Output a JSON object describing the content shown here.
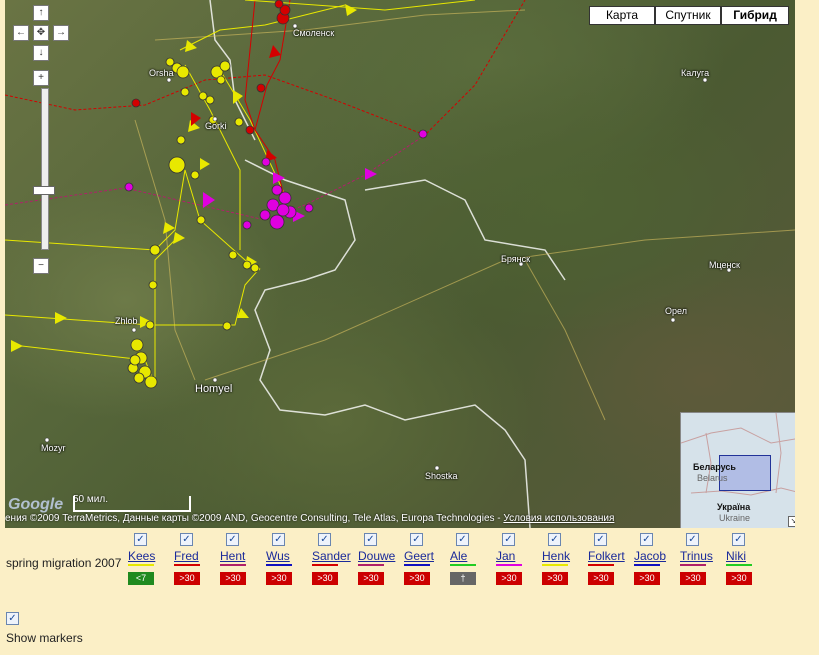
{
  "map_types": [
    "Карта",
    "Спутник",
    "Гибрид"
  ],
  "active_map_type": "Гибрид",
  "pan_arrows": {
    "up": "↑",
    "left": "←",
    "center": "✥",
    "right": "→",
    "down": "↓"
  },
  "zoom": {
    "in": "+",
    "out": "−"
  },
  "cities": [
    {
      "key": "smolensk",
      "label": "Смоленск"
    },
    {
      "key": "kaluga",
      "label": "Калуга"
    },
    {
      "key": "orsha",
      "label": "Orsha"
    },
    {
      "key": "gorki",
      "label": "Gorki"
    },
    {
      "key": "bryansk",
      "label": "Брянск"
    },
    {
      "key": "mtsensk",
      "label": "Мценск"
    },
    {
      "key": "orel",
      "label": "Орел"
    },
    {
      "key": "zhlobin",
      "label": "Zhlob"
    },
    {
      "key": "homyel",
      "label": "Homyel"
    },
    {
      "key": "mozyr",
      "label": "Mozyr"
    },
    {
      "key": "shostka",
      "label": "Shostka"
    }
  ],
  "scale_label": "50 мил.",
  "logo": "Google",
  "copyright": "ения ©2009 TerraMetrics, Данные карты ©2009 AND, Geocentre Consulting, Tele Atlas, Europa Technologies - ",
  "terms_link": "Условия использования",
  "minimap": {
    "label_belarus": "Беларусь",
    "label_belarus_en": "Belarus",
    "label_ukraine": "Україна",
    "label_ukraine_en": "Ukraine"
  },
  "legend": {
    "caption": "spring migration 2007",
    "checkbox_mark": "✓",
    "birds": [
      {
        "name": "Kees",
        "color": "#e8e800",
        "status": "<7",
        "status_color": "#1f8a1f"
      },
      {
        "name": "Fred",
        "color": "#d40000",
        "status": ">30",
        "status_color": "#cc0000"
      },
      {
        "name": "Hent",
        "color": "#b0206a",
        "status": ">30",
        "status_color": "#cc0000"
      },
      {
        "name": "Wus",
        "color": "#1010c0",
        "status": ">30",
        "status_color": "#cc0000"
      },
      {
        "name": "Sander",
        "color": "#d40000",
        "status": ">30",
        "status_color": "#cc0000"
      },
      {
        "name": "Douwe",
        "color": "#b0206a",
        "status": ">30",
        "status_color": "#cc0000"
      },
      {
        "name": "Geert",
        "color": "#1010c0",
        "status": ">30",
        "status_color": "#cc0000"
      },
      {
        "name": "Ale",
        "color": "#22cc22",
        "status": "†",
        "status_color": "#666666"
      },
      {
        "name": "Jan",
        "color": "#e000e0",
        "status": ">30",
        "status_color": "#cc0000"
      },
      {
        "name": "Henk",
        "color": "#e8e800",
        "status": ">30",
        "status_color": "#cc0000"
      },
      {
        "name": "Folkert",
        "color": "#d40000",
        "status": ">30",
        "status_color": "#cc0000"
      },
      {
        "name": "Jacob",
        "color": "#1010c0",
        "status": ">30",
        "status_color": "#cc0000"
      },
      {
        "name": "Trinus",
        "color": "#b0206a",
        "status": ">30",
        "status_color": "#cc0000"
      },
      {
        "name": "Niki",
        "color": "#22cc22",
        "status": ">30",
        "status_color": "#cc0000"
      }
    ],
    "show_markers_label": "Show markers"
  },
  "colors": {
    "background": "#fbefc6",
    "link": "#1a2a9a"
  }
}
